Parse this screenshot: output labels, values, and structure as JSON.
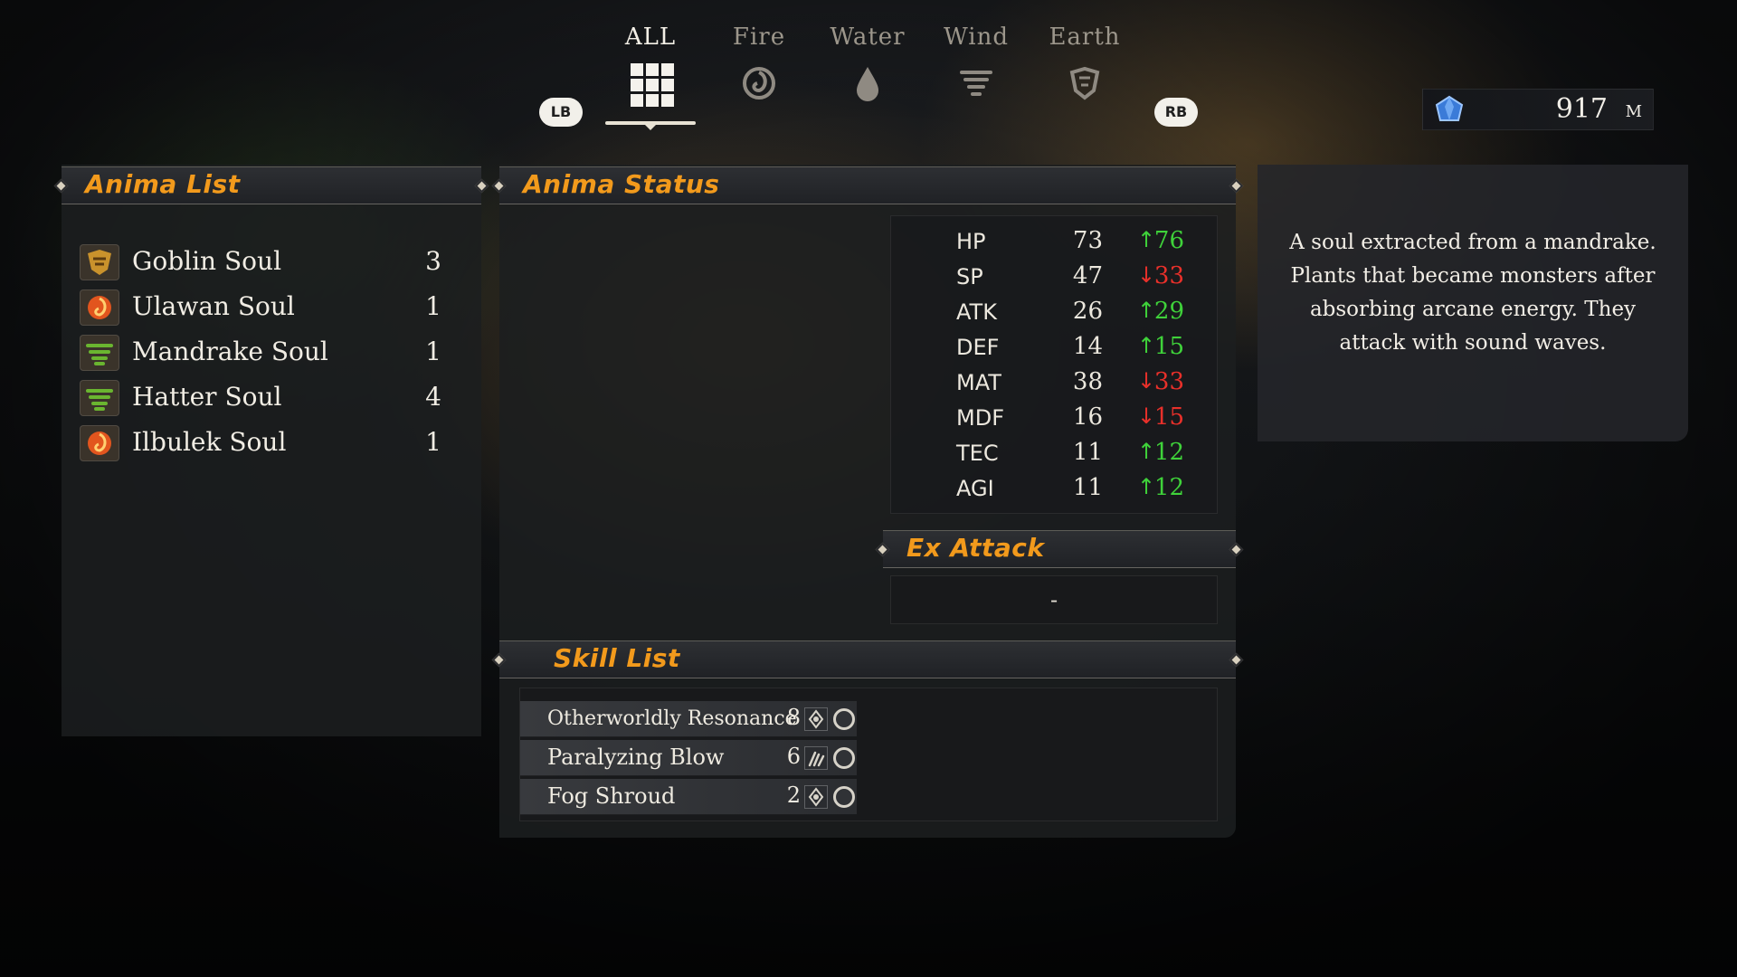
{
  "tabs": [
    {
      "label": "ALL",
      "icon": "grid-icon",
      "active": true
    },
    {
      "label": "Fire",
      "icon": "fire-swirl-icon",
      "active": false
    },
    {
      "label": "Water",
      "icon": "water-drop-icon",
      "active": false
    },
    {
      "label": "Wind",
      "icon": "wind-tornado-icon",
      "active": false
    },
    {
      "label": "Earth",
      "icon": "earth-shield-icon",
      "active": false
    }
  ],
  "buttons": {
    "left_bumper": "LB",
    "right_bumper": "RB"
  },
  "currency": {
    "icon": "blue-gem-icon",
    "value": "917",
    "unit": "M"
  },
  "anima_list": {
    "title": "Anima List",
    "items": [
      {
        "name": "Goblin Soul",
        "count": "3",
        "icon": "earth-soul-icon",
        "color": "#c9922c"
      },
      {
        "name": "Ulawan Soul",
        "count": "1",
        "icon": "fire-soul-icon",
        "color": "#e2551e"
      },
      {
        "name": "Mandrake Soul",
        "count": "1",
        "icon": "wind-soul-icon",
        "color": "#6ab530"
      },
      {
        "name": "Hatter Soul",
        "count": "4",
        "icon": "wind-soul-icon",
        "color": "#6ab530"
      },
      {
        "name": "Ilbulek Soul",
        "count": "1",
        "icon": "fire-soul-icon",
        "color": "#e2551e"
      }
    ]
  },
  "anima_status": {
    "title": "Anima Status",
    "stats": [
      {
        "name": "HP",
        "base": "73",
        "new": "76",
        "dir": "up"
      },
      {
        "name": "SP",
        "base": "47",
        "new": "33",
        "dir": "down"
      },
      {
        "name": "ATK",
        "base": "26",
        "new": "29",
        "dir": "up"
      },
      {
        "name": "DEF",
        "base": "14",
        "new": "15",
        "dir": "up"
      },
      {
        "name": "MAT",
        "base": "38",
        "new": "33",
        "dir": "down"
      },
      {
        "name": "MDF",
        "base": "16",
        "new": "15",
        "dir": "down"
      },
      {
        "name": "TEC",
        "base": "11",
        "new": "12",
        "dir": "up"
      },
      {
        "name": "AGI",
        "base": "11",
        "new": "12",
        "dir": "up"
      }
    ],
    "arrows": {
      "up": "↑",
      "down": "↓"
    },
    "colors": {
      "up": "#3fd23a",
      "down": "#e8302a"
    }
  },
  "ex_attack": {
    "title": "Ex Attack",
    "value": "-"
  },
  "skill_list": {
    "title": "Skill List",
    "skills": [
      {
        "name": "Otherworldly Resonance",
        "cost": "8",
        "type_icon": "magic-sigil-icon"
      },
      {
        "name": "Paralyzing Blow",
        "cost": "6",
        "type_icon": "claw-strike-icon"
      },
      {
        "name": "Fog Shroud",
        "cost": "2",
        "type_icon": "magic-sigil-icon"
      }
    ]
  },
  "description": "A soul extracted from a mandrake. Plants that became monsters after absorbing arcane energy. They attack with sound waves."
}
